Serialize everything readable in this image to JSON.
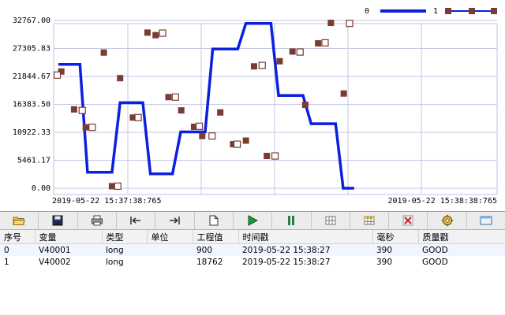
{
  "chart": {
    "legend": [
      {
        "label": "0",
        "color": "#0b1fe0",
        "style": "line"
      },
      {
        "label": "1",
        "color": "#7a3b34",
        "style": "squares"
      }
    ],
    "y_tick_labels": [
      "32767.00",
      "27305.83",
      "21844.67",
      "16383.50",
      "10922.33",
      "5461.17",
      "0.00"
    ],
    "x_start_label": "2019-05-22  15:37:38:765",
    "x_end_label": "2019-05-22  15:38:38:765"
  },
  "chart_data": {
    "type": "line",
    "ylim": [
      0,
      32767
    ],
    "xlim": [
      0,
      60
    ],
    "x_unit": "seconds since 2019-05-22 15:37:38:765",
    "grid": true,
    "legend_position": "top-right",
    "series": [
      {
        "name": "0",
        "style": "stepped line",
        "color": "#0b1fe0",
        "points": [
          [
            0,
            24200
          ],
          [
            3.7,
            24200
          ],
          [
            5,
            3100
          ],
          [
            9.2,
            3100
          ],
          [
            10.6,
            16700
          ],
          [
            14.5,
            16700
          ],
          [
            15.8,
            2800
          ],
          [
            19.6,
            2800
          ],
          [
            21,
            11000
          ],
          [
            25.2,
            11000
          ],
          [
            26.5,
            27200
          ],
          [
            30.8,
            27200
          ],
          [
            32.2,
            32200
          ],
          [
            36.5,
            32200
          ],
          [
            37.8,
            18100
          ],
          [
            42,
            18100
          ],
          [
            43.4,
            12600
          ],
          [
            47.6,
            12600
          ],
          [
            48.9,
            0
          ],
          [
            50.8,
            0
          ]
        ]
      },
      {
        "name": "1",
        "style": "square markers (filled + hollow)",
        "color": "#7a3b34",
        "filled": [
          [
            0.5,
            22800
          ],
          [
            2.7,
            15400
          ],
          [
            4.7,
            11900
          ],
          [
            7.8,
            26500
          ],
          [
            9.2,
            400
          ],
          [
            10.6,
            21500
          ],
          [
            12.8,
            13800
          ],
          [
            15.3,
            30400
          ],
          [
            16.7,
            29900
          ],
          [
            18.9,
            17800
          ],
          [
            21.1,
            15200
          ],
          [
            23.3,
            12000
          ],
          [
            24.7,
            10200
          ],
          [
            27.8,
            14800
          ],
          [
            30.0,
            8600
          ],
          [
            32.2,
            9300
          ],
          [
            33.6,
            23800
          ],
          [
            35.8,
            6300
          ],
          [
            38.0,
            24800
          ],
          [
            40.2,
            26700
          ],
          [
            42.4,
            16300
          ],
          [
            44.6,
            28300
          ],
          [
            46.8,
            32300
          ],
          [
            49.0,
            18500
          ]
        ],
        "hollow": [
          [
            -0.2,
            22100
          ],
          [
            4.1,
            15200
          ],
          [
            5.8,
            11900
          ],
          [
            10.2,
            400
          ],
          [
            13.7,
            13800
          ],
          [
            17.9,
            30300
          ],
          [
            20.1,
            17800
          ],
          [
            24.2,
            12100
          ],
          [
            26.4,
            10200
          ],
          [
            30.7,
            8600
          ],
          [
            35.0,
            24000
          ],
          [
            37.2,
            6300
          ],
          [
            41.5,
            26600
          ],
          [
            45.8,
            28400
          ],
          [
            50.0,
            32200
          ]
        ]
      }
    ]
  },
  "toolbar": {
    "buttons": [
      {
        "name": "open-folder-button",
        "icon": "folder-icon"
      },
      {
        "name": "save-button",
        "icon": "floppy-disk-icon"
      },
      {
        "name": "print-button",
        "icon": "printer-icon"
      },
      {
        "name": "scroll-left-button",
        "icon": "arrow-left-bar-icon"
      },
      {
        "name": "scroll-right-button",
        "icon": "arrow-right-bar-icon"
      },
      {
        "name": "new-document-button",
        "icon": "document-icon"
      },
      {
        "name": "play-button",
        "icon": "play-icon"
      },
      {
        "name": "pause-button",
        "icon": "pause-icon"
      },
      {
        "name": "grid-view-button",
        "icon": "grid-icon"
      },
      {
        "name": "table-view-button",
        "icon": "table-icon"
      },
      {
        "name": "delete-button",
        "icon": "red-x-icon"
      },
      {
        "name": "settings-button",
        "icon": "gear-icon"
      },
      {
        "name": "window-button",
        "icon": "window-icon"
      }
    ]
  },
  "table": {
    "columns": [
      "序号",
      "变量",
      "类型",
      "单位",
      "工程值",
      "时间戳",
      "毫秒",
      "质量戳"
    ],
    "rows": [
      [
        "0",
        "V40001",
        "long",
        "",
        "900",
        "2019-05-22 15:38:27",
        "390",
        "GOOD"
      ],
      [
        "1",
        "V40002",
        "long",
        "",
        "18762",
        "2019-05-22 15:38:27",
        "390",
        "GOOD"
      ]
    ]
  }
}
